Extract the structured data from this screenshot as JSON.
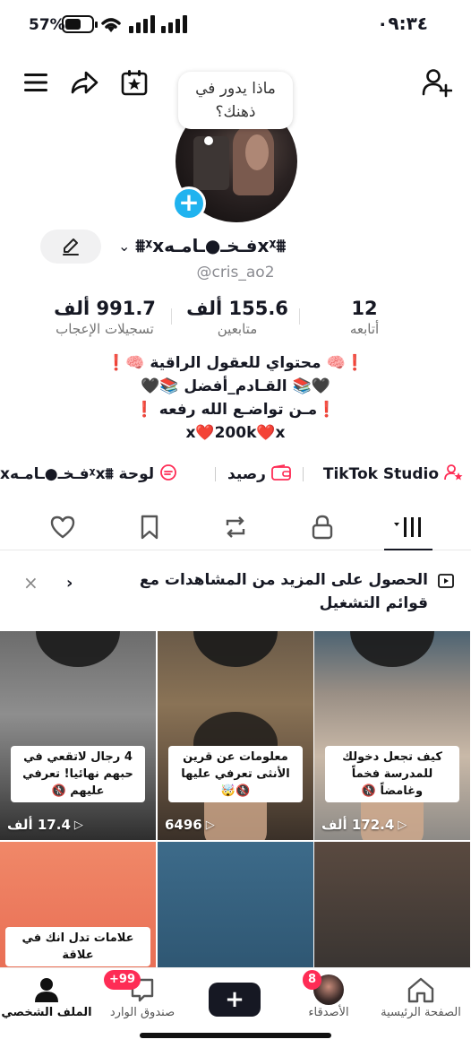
{
  "status_bar": {
    "battery_percent": "57%",
    "time": "٠٩:٣٤"
  },
  "profile": {
    "thought_bubble": "ماذا يدور في ذهنك؟",
    "display_name": "⩩ᵡ𝘅فـخـ●ـامـه𝘅ᵡ⩩",
    "handle": "@cris_ao2",
    "stats": {
      "following_value": "12",
      "following_label": "أتابعه",
      "followers_value": "155.6 ألف",
      "followers_label": "متابعين",
      "likes_value": "991.7 ألف",
      "likes_label": "تسجيلات الإعجاب"
    },
    "bio_lines": [
      "❗🧠 محتواي للعقول الراقية 🧠❗",
      "🖤📚 القـادم_أفضل 📚🖤",
      "❗مـن تواضـع الله رفعه ❗",
      "𝘅❤️200k❤️𝘅"
    ]
  },
  "links": {
    "studio": "TikTok Studio",
    "balance": "رصيد",
    "board": "لوحة ⩩ᵡ𝘅فـخـ●ـامـه𝘅"
  },
  "banner": {
    "text": "الحصول على المزيد من المشاهدات مع قوائم التشغيل"
  },
  "videos": [
    {
      "caption": "كيف تجعل دخولك للمدرسة فخماً وغامضاً 🚷",
      "views": "172.4 ألف"
    },
    {
      "caption": "معلومات عن قرين الأنثى تعرفي عليها 🚷🤯",
      "views": "6496"
    },
    {
      "caption": "4 رجال لاتقعي في حبهم نهائيا! تعرفي عليهم 🚷",
      "views": "17.4 ألف"
    },
    {
      "caption": ""
    },
    {
      "caption": ""
    },
    {
      "caption": "علامات تدل انك في علاقة"
    }
  ],
  "bottom_nav": {
    "home": "الصفحة الرئيسية",
    "friends": "الأصدقاء",
    "friends_badge": "8",
    "inbox": "صندوق الوارد",
    "inbox_badge": "+99",
    "profile": "الملف الشخصي"
  },
  "colors": {
    "accent": "#fe2c55",
    "add_avatar": "#20b3ef",
    "create_cyan": "#25f4ee"
  }
}
